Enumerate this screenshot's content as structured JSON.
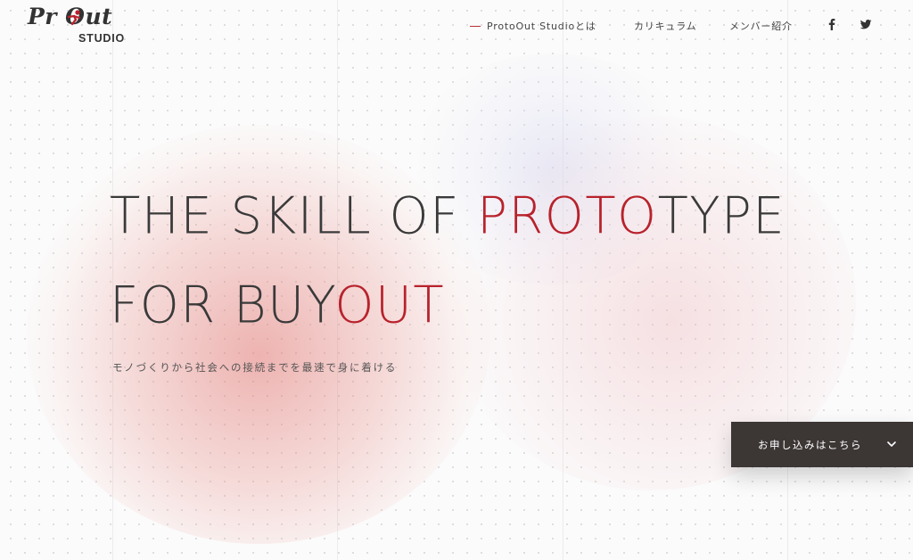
{
  "logo": {
    "top": "Pr  Out",
    "bottom": "STUDIO",
    "mark": "running-figure-icon"
  },
  "nav": {
    "items": [
      {
        "label": "ProtoOut Studioとは",
        "active": true
      },
      {
        "label": "カリキュラム"
      },
      {
        "label": "メンバー紹介"
      }
    ],
    "social": [
      "facebook-icon",
      "twitter-icon"
    ]
  },
  "hero": {
    "line1_prefix": "THE SKILL OF ",
    "line1_accent": "PROTO",
    "line1_suffix": "TYPE",
    "line2_prefix": "FOR BUY",
    "line2_accent": "OUT",
    "tagline": "モノづくりから社会への接続までを最速で身に着ける"
  },
  "cta": {
    "label": "お申し込みはこちら",
    "icon": "chevron-down-icon"
  },
  "colors": {
    "accent": "#b8222c",
    "button_bg": "#3c3635",
    "text": "#3a3a3a"
  }
}
